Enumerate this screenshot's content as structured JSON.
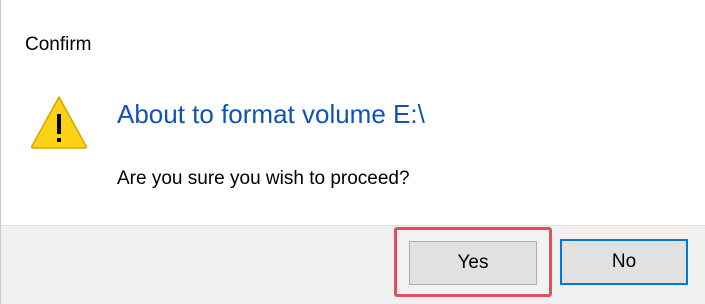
{
  "window": {
    "title": "Confirm"
  },
  "content": {
    "main_instruction": "About to format volume E:\\",
    "message": "Are you sure you wish to proceed?",
    "icon": "warning-icon"
  },
  "buttons": {
    "yes_label": "Yes",
    "no_label": "No",
    "default_button": "No"
  },
  "colors": {
    "instruction_text": "#0f52b8",
    "footer_background": "#f0f0f0",
    "highlight_border": "#e0505a",
    "focus_border": "#0078d7",
    "warning_fill": "#fcd116"
  }
}
